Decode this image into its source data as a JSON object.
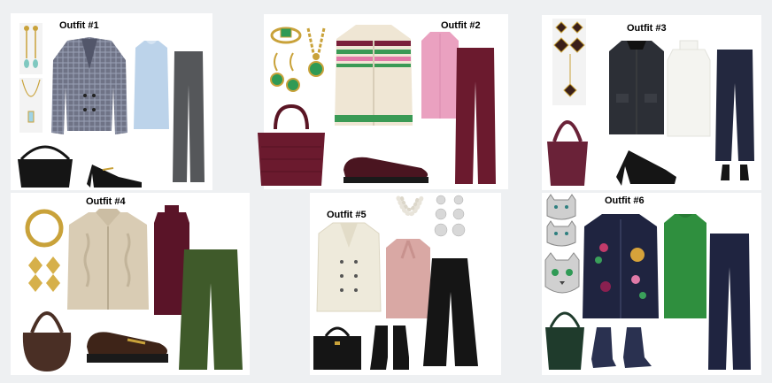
{
  "board": {
    "outfits": [
      {
        "id": "outfit-1",
        "title": "Outfit #1",
        "items": [
          "drop-earrings",
          "pendant-necklace",
          "tweed-blazer",
          "blue-sweater",
          "grey-trousers",
          "black-shoulder-bag",
          "black-mary-jane-pumps"
        ]
      },
      {
        "id": "outfit-2",
        "title": "Outfit #2",
        "items": [
          "emerald-ring",
          "emerald-earrings",
          "gold-chain-necklace",
          "fair-isle-cardigan",
          "pink-shirt",
          "burgundy-corduroy-trousers",
          "croc-tote-bag",
          "burgundy-loafers"
        ]
      },
      {
        "id": "outfit-3",
        "title": "Outfit #3",
        "items": [
          "quatrefoil-drop-earrings",
          "pendant-necklace",
          "black-knit-jacket",
          "white-turtleneck",
          "navy-leather-cropped-trousers",
          "burgundy-suede-hobo-bag",
          "black-slingback-mules"
        ]
      },
      {
        "id": "outfit-4",
        "title": "Outfit #4",
        "items": [
          "gold-collar-necklace",
          "gold-geometric-earrings",
          "cable-knit-zip-cardigan",
          "burgundy-turtleneck",
          "green-corduroy-trousers",
          "brown-hobo-bag",
          "brown-horsebit-loafers"
        ]
      },
      {
        "id": "outfit-5",
        "title": "Outfit #5",
        "items": [
          "pearl-necklace",
          "floral-drop-earrings",
          "cream-peacoat",
          "pink-tie-neck-sweater",
          "black-flared-trousers",
          "black-structured-handbag",
          "black-ankle-boots"
        ]
      },
      {
        "id": "outfit-6",
        "title": "Outfit #6",
        "items": [
          "cat-earrings",
          "cat-brooch",
          "embellished-navy-cardigan",
          "green-sweater",
          "navy-corduroy-trousers",
          "green-bucket-bag",
          "navy-suede-ankle-boots"
        ]
      }
    ]
  },
  "colors": {
    "background": "#eef0f2",
    "panel": "#ffffff",
    "tweed": "#6f7386",
    "light_blue": "#bcd3ea",
    "grey_trouser": "#55575a",
    "burgundy": "#6b1a2e",
    "pink": "#eaa1c0",
    "cream": "#efe6d4",
    "emerald": "#2f9a55",
    "gold": "#c9a23a",
    "charcoal": "#2c2f36",
    "navy_leather": "#23283f",
    "suede_burgundy": "#6a2238",
    "oat": "#d9ccb4",
    "forest_green": "#3f5a2a",
    "brown": "#4a2f25",
    "ivory": "#eeeadb",
    "blush": "#d9a8a4",
    "black": "#151515",
    "navy": "#1f2440",
    "kelly_green": "#2f8f3e",
    "bottle_green": "#1f3b2c"
  }
}
